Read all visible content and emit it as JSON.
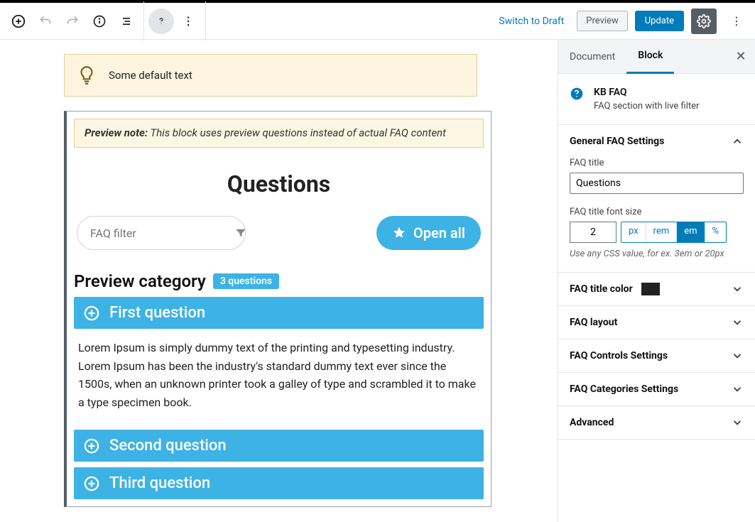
{
  "toolbar": {
    "switch_draft": "Switch to Draft",
    "preview": "Preview",
    "update": "Update"
  },
  "sidebar": {
    "tabs": {
      "document": "Document",
      "block": "Block"
    },
    "block_info": {
      "title": "KB FAQ",
      "desc": "FAQ section with live filter"
    },
    "panels": {
      "general": {
        "title": "General FAQ Settings",
        "faq_title_label": "FAQ title",
        "faq_title_value": "Questions",
        "font_size_label": "FAQ title font size",
        "font_size_value": "2",
        "units": [
          "px",
          "rem",
          "em",
          "%"
        ],
        "unit_active": "em",
        "help": "Use any CSS value, for ex. 3em or 20px"
      },
      "color": {
        "title": "FAQ title color"
      },
      "layout": {
        "title": "FAQ layout"
      },
      "controls": {
        "title": "FAQ Controls Settings"
      },
      "categories": {
        "title": "FAQ Categories Settings"
      },
      "advanced": {
        "title": "Advanced"
      }
    }
  },
  "editor": {
    "tip": "Some default text",
    "preview_note_label": "Preview note:",
    "preview_note_text": " This block uses preview questions instead of actual FAQ content",
    "faq_title": "Questions",
    "filter_placeholder": "FAQ filter",
    "open_all": "Open all",
    "category": "Preview category",
    "badge": "3 questions",
    "questions": [
      {
        "q": "First question",
        "a": "Lorem Ipsum is simply dummy text of the printing and typesetting industry. Lorem Ipsum has been the industry's standard dummy text ever since the 1500s, when an unknown printer took a galley of type and scrambled it to make a type specimen book."
      },
      {
        "q": "Second question"
      },
      {
        "q": "Third question"
      }
    ]
  }
}
